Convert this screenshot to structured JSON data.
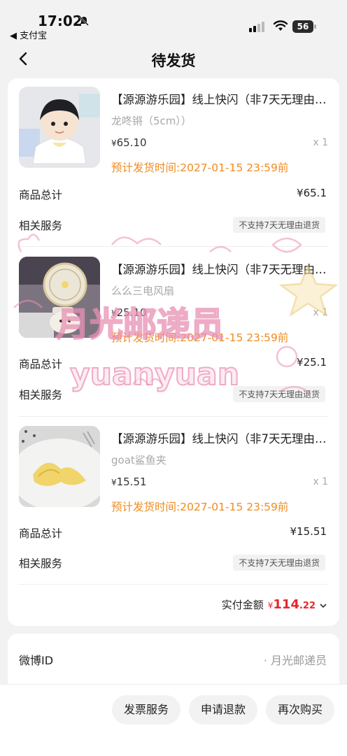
{
  "status_bar": {
    "time": "17:02",
    "back_app": "◀ 支付宝",
    "battery": "56"
  },
  "nav": {
    "title": "待发货"
  },
  "order": {
    "items": [
      {
        "title": "【源源游乐园】线上快闪（非7天无理由退货）",
        "spec": "龙咚锵（5cm））",
        "price": "65.10",
        "currency": "¥",
        "qty": "x 1",
        "ship_time": "预计发货时间:2027-01-15 23:59前",
        "total_label": "商品总计",
        "total_value": "¥65.1",
        "service_label": "相关服务",
        "service_badge": "不支持7天无理由退货"
      },
      {
        "title": "【源源游乐园】线上快闪（非7天无理由退货）",
        "spec": "么么三电风扇",
        "price": "25.10",
        "currency": "¥",
        "qty": "x 1",
        "ship_time": "预计发货时间:2027-01-15 23:59前",
        "total_label": "商品总计",
        "total_value": "¥25.1",
        "service_label": "相关服务",
        "service_badge": "不支持7天无理由退货"
      },
      {
        "title": "【源源游乐园】线上快闪（非7天无理由退货）",
        "spec": "goat鲨鱼夹",
        "price": "15.51",
        "currency": "¥",
        "qty": "x 1",
        "ship_time": "预计发货时间:2027-01-15 23:59前",
        "total_label": "商品总计",
        "total_value": "¥15.51",
        "service_label": "相关服务",
        "service_badge": "不支持7天无理由退货"
      }
    ],
    "paid_label": "实付金额",
    "paid_currency": "¥",
    "paid_int": "114",
    "paid_dec": ".22"
  },
  "weibo": {
    "label": "微博ID",
    "value": "· 月光邮递员"
  },
  "actions": {
    "invoice": "发票服务",
    "refund": "申请退款",
    "rebuy": "再次购买"
  },
  "watermark": {
    "line1": "月光邮递员",
    "line2": "yuanyuan"
  },
  "colors": {
    "orange": "#ef8c1f",
    "red": "#e8262e",
    "watermark_pink": "#e98fb4"
  }
}
